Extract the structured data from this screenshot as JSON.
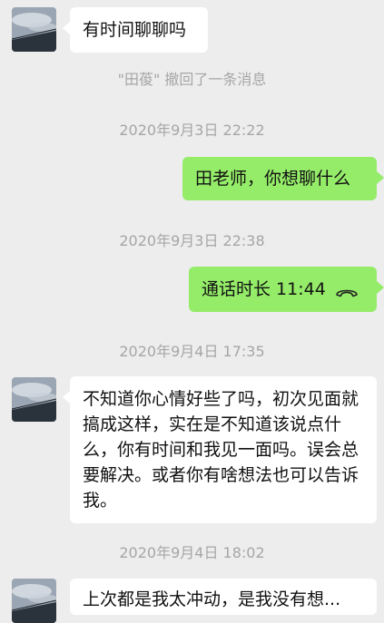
{
  "messages": {
    "m1_text": "有时间聊聊吗",
    "recall_notice": "\"田葰\" 撤回了一条消息",
    "ts1": "2020年9月3日 22:22",
    "m2_text": "田老师，你想聊什么",
    "ts2": "2020年9月3日 22:38",
    "call_label": "通话时长 11:44",
    "ts3": "2020年9月4日 17:35",
    "m3_text": "不知道你心情好些了吗，初次见面就搞成这样，实在是不知道该说点什么，你有时间和我见一面吗。误会总要解决。或者你有啥想法也可以告诉我。",
    "ts4": "2020年9月4日 18:02",
    "m4_partial": "上次都是我太冲动，是我没有想..."
  },
  "colors": {
    "background": "#ededed",
    "incoming_bubble": "#ffffff",
    "outgoing_bubble": "#95ec69",
    "timestamp_text": "#a6a6a6"
  },
  "icons": {
    "avatar": "sky-photo-avatar",
    "call": "phone-hangup-icon"
  }
}
